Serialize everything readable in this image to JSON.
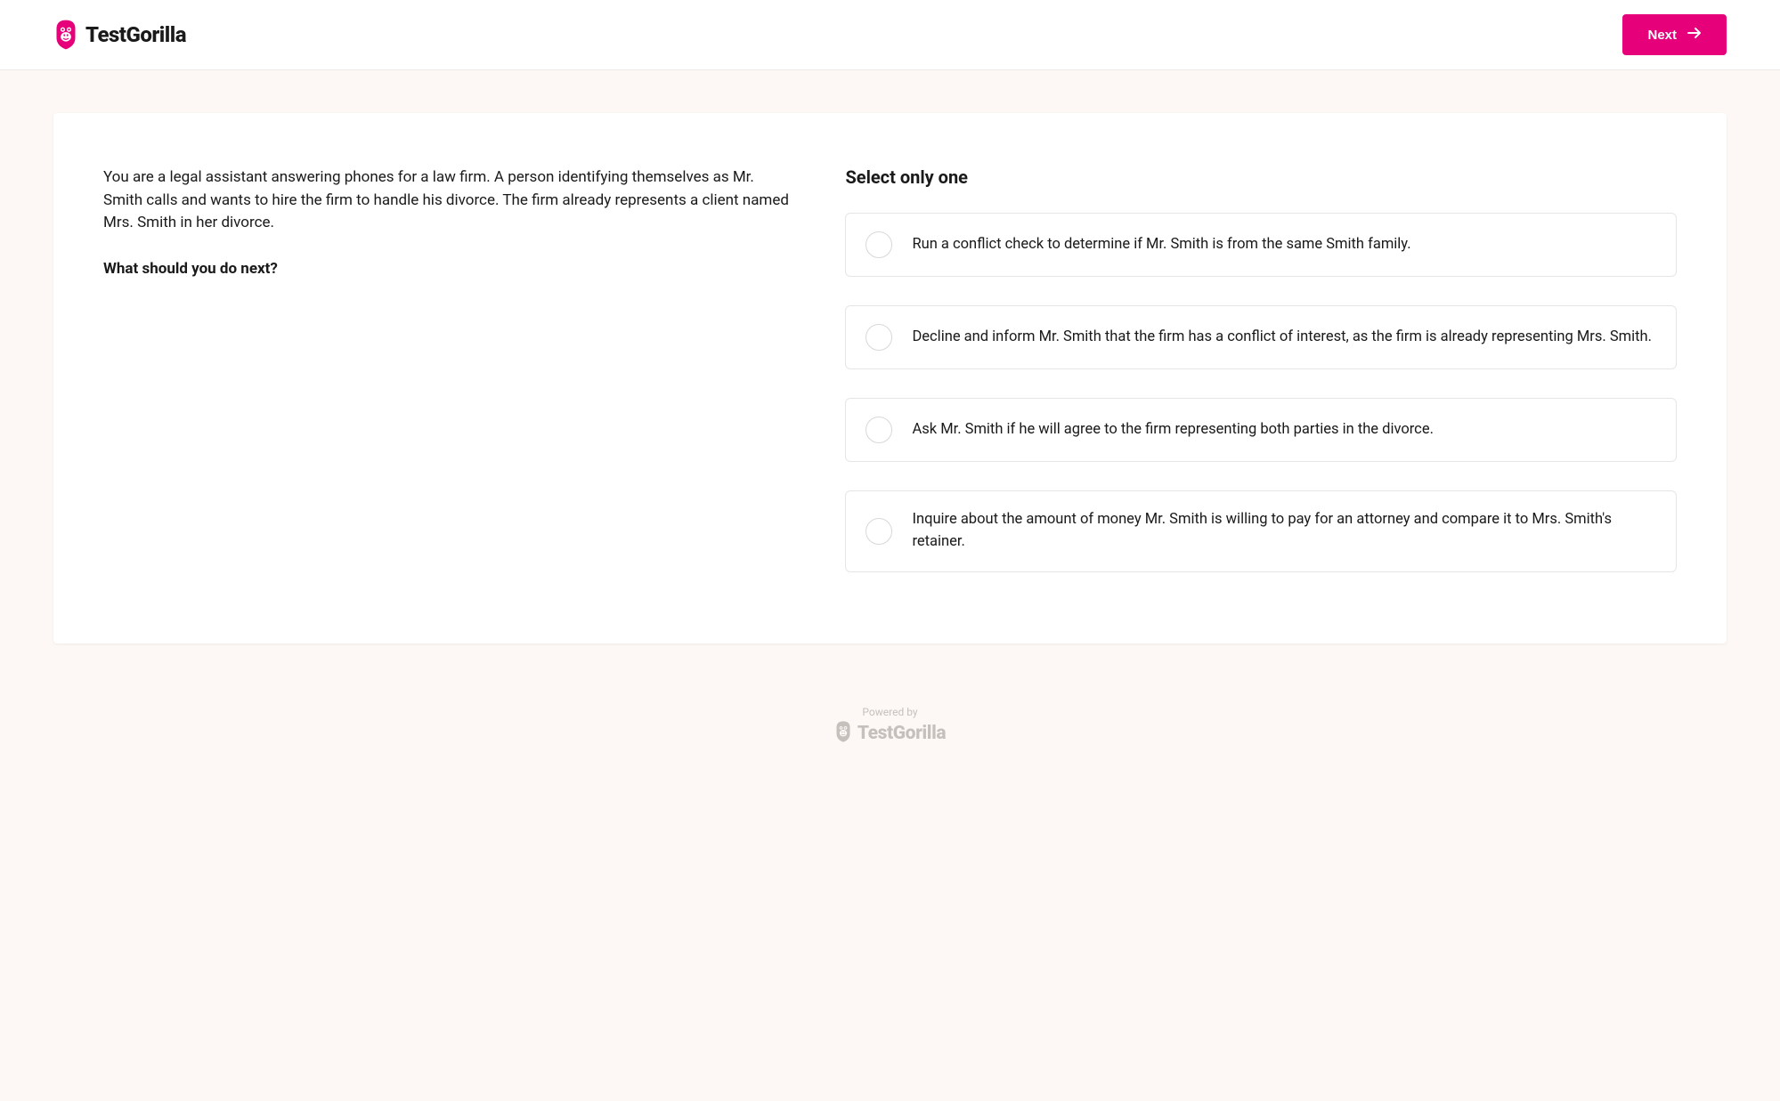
{
  "brand": {
    "name": "TestGorilla",
    "accent_color": "#e6007a"
  },
  "header": {
    "next_button_label": "Next"
  },
  "question": {
    "scenario": "You are a legal assistant answering phones for a law firm. A person identifying themselves as Mr. Smith calls and wants to hire the firm to handle his divorce. The firm already represents a client named Mrs. Smith in her divorce.",
    "prompt": "What should you do next?",
    "instruction": "Select only one",
    "options": [
      "Run a conflict check to determine if Mr. Smith is from the same Smith family.",
      "Decline and inform Mr. Smith that the firm has a conflict of interest, as the firm is already representing Mrs. Smith.",
      "Ask Mr. Smith if he will agree to the firm representing both parties in the divorce.",
      "Inquire about the amount of money Mr. Smith is willing to pay for an attorney and compare it to Mrs. Smith's retainer."
    ]
  },
  "footer": {
    "powered_by_label": "Powered by",
    "brand_name": "TestGorilla"
  }
}
